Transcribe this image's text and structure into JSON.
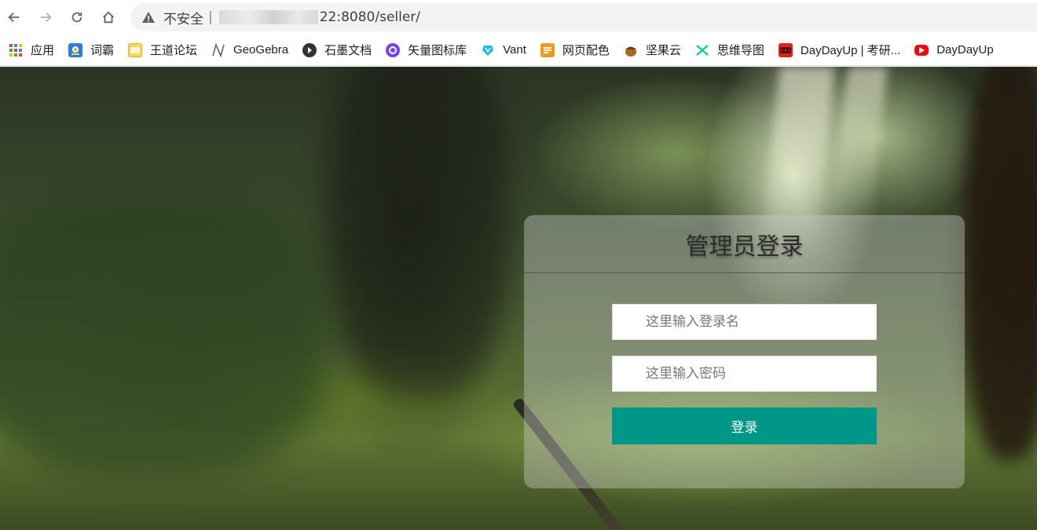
{
  "browser": {
    "address": {
      "security_label": "不安全",
      "separator": "|",
      "host_suffix": "22:8080/seller/",
      "visible_url_fragments": [
        ":",
        "."
      ]
    }
  },
  "bookmarks": [
    {
      "label": "应用",
      "icon": "apps-grid-icon"
    },
    {
      "label": "词霸",
      "icon": "ciba-icon"
    },
    {
      "label": "王道论坛",
      "icon": "wangdao-icon"
    },
    {
      "label": "GeoGebra",
      "icon": "geogebra-icon"
    },
    {
      "label": "石墨文档",
      "icon": "shimo-icon"
    },
    {
      "label": "矢量图标库",
      "icon": "iconfont-icon"
    },
    {
      "label": "Vant",
      "icon": "vant-icon"
    },
    {
      "label": "网页配色",
      "icon": "palette-icon"
    },
    {
      "label": "坚果云",
      "icon": "nutstore-icon"
    },
    {
      "label": "思维导图",
      "icon": "mindmap-icon"
    },
    {
      "label": "DayDayUp | 考研...",
      "icon": "daydayup-icon"
    },
    {
      "label": "DayDayUp",
      "icon": "youtube-icon"
    }
  ],
  "login": {
    "title": "管理员登录",
    "username_placeholder": "这里输入登录名",
    "password_placeholder": "这里输入密码",
    "submit_label": "登录"
  },
  "colors": {
    "primary_button": "#009688"
  }
}
